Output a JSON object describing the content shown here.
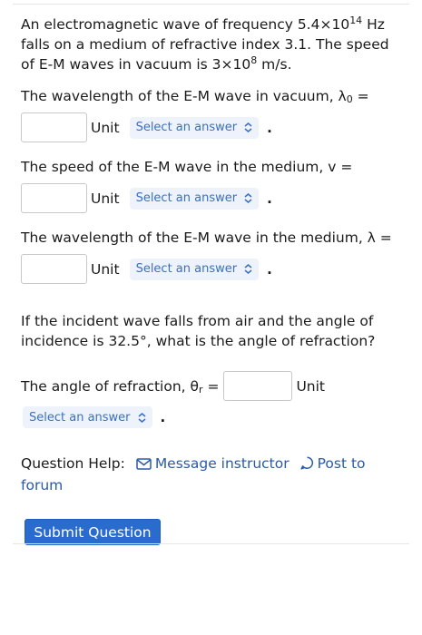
{
  "problem": {
    "intro_part1": "An electromagnetic wave of frequency 5.4×10",
    "intro_exp1": "14",
    "intro_part2": " Hz falls on a medium of refractive index 3.1. The speed of E-M waves in vacuum is 3×10",
    "intro_exp2": "8",
    "intro_part3": " m/s."
  },
  "questions": [
    {
      "prefix": "The wavelength of the E-M wave in vacuum, λ",
      "sub": "0",
      "suffix": " =",
      "unit_label": "Unit",
      "select_label": "Select an answer",
      "input_value": "",
      "end": "."
    },
    {
      "prefix": "The speed of the E-M wave in the medium, v =",
      "sub": "",
      "suffix": "",
      "unit_label": "Unit",
      "select_label": "Select an answer",
      "input_value": "",
      "end": "."
    },
    {
      "prefix": "The wavelength of the E-M wave in the medium, λ =",
      "sub": "",
      "suffix": "",
      "unit_label": "Unit",
      "select_label": "Select an answer",
      "input_value": "",
      "end": "."
    }
  ],
  "refraction": {
    "text": "If the incident wave falls from air and the angle of incidence is 32.5°, what is the angle of refraction?",
    "prefix": "The angle of refraction, θ",
    "sub": "r",
    "suffix": " =",
    "unit_label": "Unit",
    "select_label": "Select an answer",
    "input_value": "",
    "end": "."
  },
  "help": {
    "label": "Question Help:",
    "message_label": "Message instructor",
    "post_label": "Post to forum"
  },
  "submit_label": "Submit Question"
}
